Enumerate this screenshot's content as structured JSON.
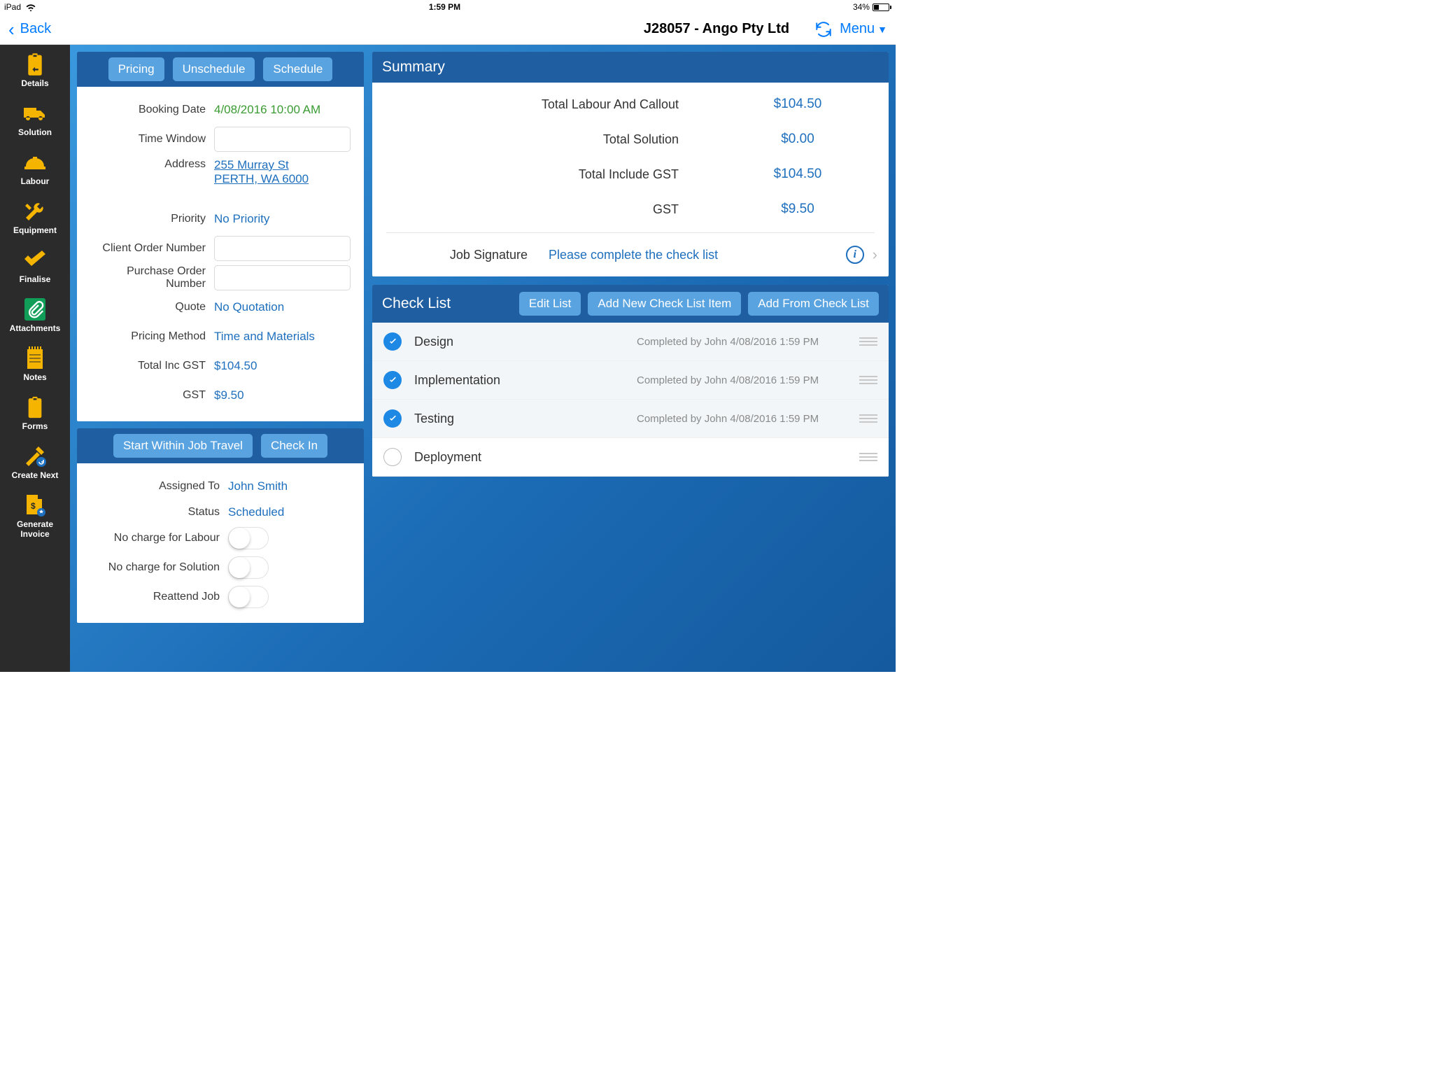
{
  "status": {
    "device": "iPad",
    "time": "1:59 PM",
    "battery": "34%"
  },
  "nav": {
    "back": "Back",
    "title": "J28057 - Ango Pty Ltd",
    "menu": "Menu"
  },
  "sidebar": {
    "items": [
      {
        "label": "Details"
      },
      {
        "label": "Solution"
      },
      {
        "label": "Labour"
      },
      {
        "label": "Equipment"
      },
      {
        "label": "Finalise"
      },
      {
        "label": "Attachments"
      },
      {
        "label": "Notes"
      },
      {
        "label": "Forms"
      },
      {
        "label": "Create Next"
      },
      {
        "label": "Generate Invoice"
      }
    ]
  },
  "details": {
    "buttons": {
      "pricing": "Pricing",
      "unschedule": "Unschedule",
      "schedule": "Schedule"
    },
    "booking_date_label": "Booking Date",
    "booking_date": "4/08/2016 10:00 AM",
    "time_window_label": "Time Window",
    "time_window": "",
    "address_label": "Address",
    "address_line1": "255 Murray St",
    "address_line2": "PERTH, WA 6000",
    "priority_label": "Priority",
    "priority": "No Priority",
    "client_order_label": "Client Order Number",
    "client_order": "",
    "purchase_order_label": "Purchase Order Number",
    "purchase_order": "",
    "quote_label": "Quote",
    "quote": "No Quotation",
    "pricing_method_label": "Pricing Method",
    "pricing_method": "Time and Materials",
    "total_inc_gst_label": "Total Inc GST",
    "total_inc_gst": "$104.50",
    "gst_label": "GST",
    "gst": "$9.50"
  },
  "assignment": {
    "buttons": {
      "start_travel": "Start Within Job Travel",
      "check_in": "Check In"
    },
    "assigned_to_label": "Assigned To",
    "assigned_to": "John Smith",
    "status_label": "Status",
    "status": "Scheduled",
    "no_charge_labour_label": "No charge for Labour",
    "no_charge_solution_label": "No charge for Solution",
    "reattend_label": "Reattend Job"
  },
  "summary": {
    "title": "Summary",
    "rows": [
      {
        "label": "Total Labour And Callout",
        "value": "$104.50"
      },
      {
        "label": "Total Solution",
        "value": "$0.00"
      },
      {
        "label": "Total Include GST",
        "value": "$104.50"
      },
      {
        "label": "GST",
        "value": "$9.50"
      }
    ],
    "sig_label": "Job Signature",
    "sig_link": "Please complete the check list"
  },
  "checklist": {
    "title": "Check List",
    "buttons": {
      "edit": "Edit List",
      "add_item": "Add New Check List Item",
      "add_from": "Add From Check List"
    },
    "items": [
      {
        "title": "Design",
        "done": true,
        "meta": "Completed by John 4/08/2016 1:59 PM"
      },
      {
        "title": "Implementation",
        "done": true,
        "meta": "Completed by John 4/08/2016 1:59 PM"
      },
      {
        "title": "Testing",
        "done": true,
        "meta": "Completed by John 4/08/2016 1:59 PM"
      },
      {
        "title": "Deployment",
        "done": false,
        "meta": ""
      }
    ]
  }
}
